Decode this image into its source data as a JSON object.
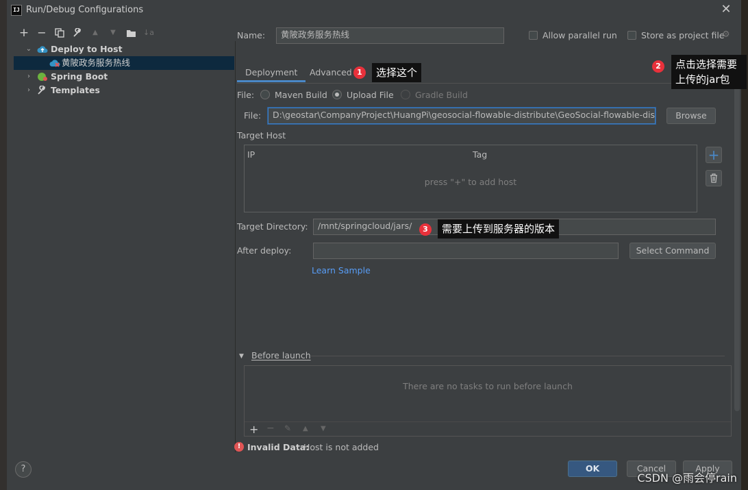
{
  "window": {
    "title": "Run/Debug Configurations",
    "app_icon_text": "IJ"
  },
  "toolbar": {
    "add": "+",
    "remove": "−",
    "copy": "⧉",
    "settings": "🔧",
    "up": "▲",
    "down": "▼",
    "folder": "📁",
    "sort": "↓a"
  },
  "tree": {
    "items": [
      {
        "label": "Deploy to Host",
        "expanded": true
      },
      {
        "label": "黄陂政务服务热线",
        "selected": true
      },
      {
        "label": "Spring Boot",
        "expanded": false
      },
      {
        "label": "Templates",
        "expanded": false
      }
    ]
  },
  "form": {
    "name_label": "Name:",
    "name_value": "黄陂政务服务热线",
    "allow_parallel_label": "Allow parallel run",
    "store_project_label": "Store as project file",
    "tabs": [
      "Deployment",
      "Advanced"
    ],
    "file_type_label": "File:",
    "file_options": [
      "Maven Build",
      "Upload File",
      "Gradle Build"
    ],
    "selected_file_option": "Upload File",
    "file_label": "File:",
    "file_path": "D:\\geostar\\CompanyProject\\HuangPi\\geosocial-flowable-distribute\\GeoSocial-flowable-distribu",
    "browse_button": "Browse",
    "target_host_label": "Target Host",
    "host_columns": [
      "IP",
      "Tag"
    ],
    "host_empty_text": "press \"+\" to add host",
    "target_dir_label": "Target Directory:",
    "target_dir_value": "/mnt/springcloud/jars/",
    "after_deploy_label": "After deploy:",
    "after_deploy_value": "",
    "select_command_button": "Select Command",
    "learn_sample_link": "Learn Sample",
    "before_launch_label": "Before launch",
    "before_launch_empty": "There are no tasks to run before launch",
    "error_label": "Invalid Data:",
    "error_text": "Host is not added"
  },
  "buttons": {
    "ok": "OK",
    "cancel": "Cancel",
    "apply": "Apply",
    "help": "?"
  },
  "annotations": [
    {
      "num": "1",
      "text": "选择这个"
    },
    {
      "num": "2",
      "line1": "点击选择需要",
      "line2": "上传的jar包"
    },
    {
      "num": "3",
      "text": "需要上传到服务器的版本"
    }
  ],
  "watermark": "CSDN @雨会停rain",
  "colors": {
    "accent": "#4a88c7",
    "selection": "#0d293e",
    "link": "#589df6",
    "badge": "#e8313b",
    "error": "#e05555"
  }
}
